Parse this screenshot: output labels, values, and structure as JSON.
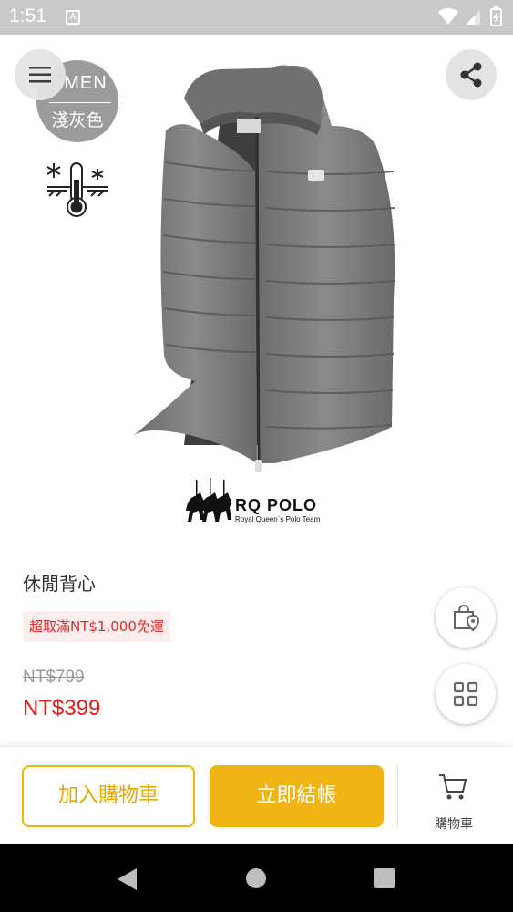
{
  "status_bar": {
    "time": "1:51",
    "notification_icon": "A"
  },
  "product_image": {
    "gender_label": "MEN",
    "color_label": "淺灰色",
    "season_icon": "cold-weather-thermometer-icon",
    "brand": {
      "name": "RQ POLO",
      "tagline": "Royal Queen`s Polo Team"
    }
  },
  "product": {
    "name": "休閒背心",
    "promo": "超取滿NT$1,000免運",
    "original_price": "NT$799",
    "sale_price": "NT$399"
  },
  "action_bar": {
    "add_to_cart": "加入購物車",
    "checkout": "立即結帳",
    "cart_label": "購物車"
  },
  "colors": {
    "accent": "#f0b514",
    "price_red": "#e51c1c",
    "status_bar": "#c9c9c9"
  }
}
